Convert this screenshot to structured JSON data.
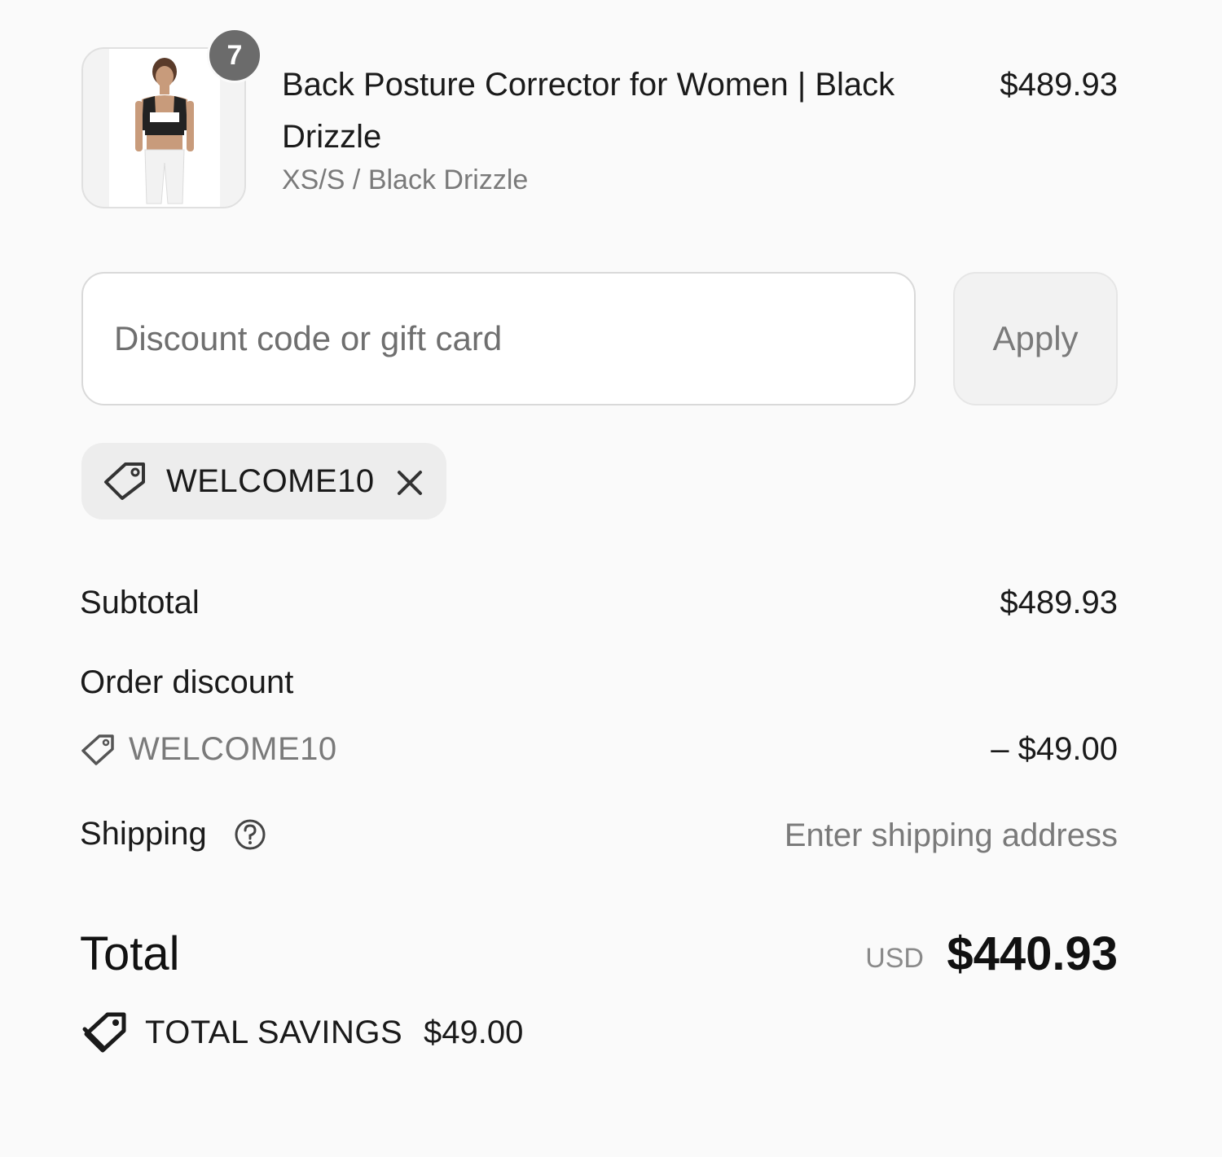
{
  "product": {
    "quantity": "7",
    "title": "Back Posture Corrector for Women | Black Drizzle",
    "variant": "XS/S / Black Drizzle",
    "price": "$489.93",
    "image_icon": "product-photo"
  },
  "discount": {
    "placeholder": "Discount code or gift card",
    "value": "",
    "apply_label": "Apply",
    "applied_code": "WELCOME10"
  },
  "summary": {
    "subtotal_label": "Subtotal",
    "subtotal_value": "$489.93",
    "order_discount_label": "Order discount",
    "discount_code": "WELCOME10",
    "discount_value": "– $49.00",
    "shipping_label": "Shipping",
    "shipping_value": "Enter shipping address",
    "total_label": "Total",
    "currency": "USD",
    "total_value": "$440.93",
    "savings_label": "TOTAL SAVINGS",
    "savings_value": "$49.00"
  },
  "icons": {
    "tag": "tag-icon",
    "close": "close-icon",
    "help": "help-circle-icon",
    "savings": "tags-icon"
  },
  "colors": {
    "background": "#fafafa",
    "text": "#1a1a1a",
    "muted": "#7a7a7a",
    "badge": "#6b6b6b",
    "chip": "#ededed"
  }
}
